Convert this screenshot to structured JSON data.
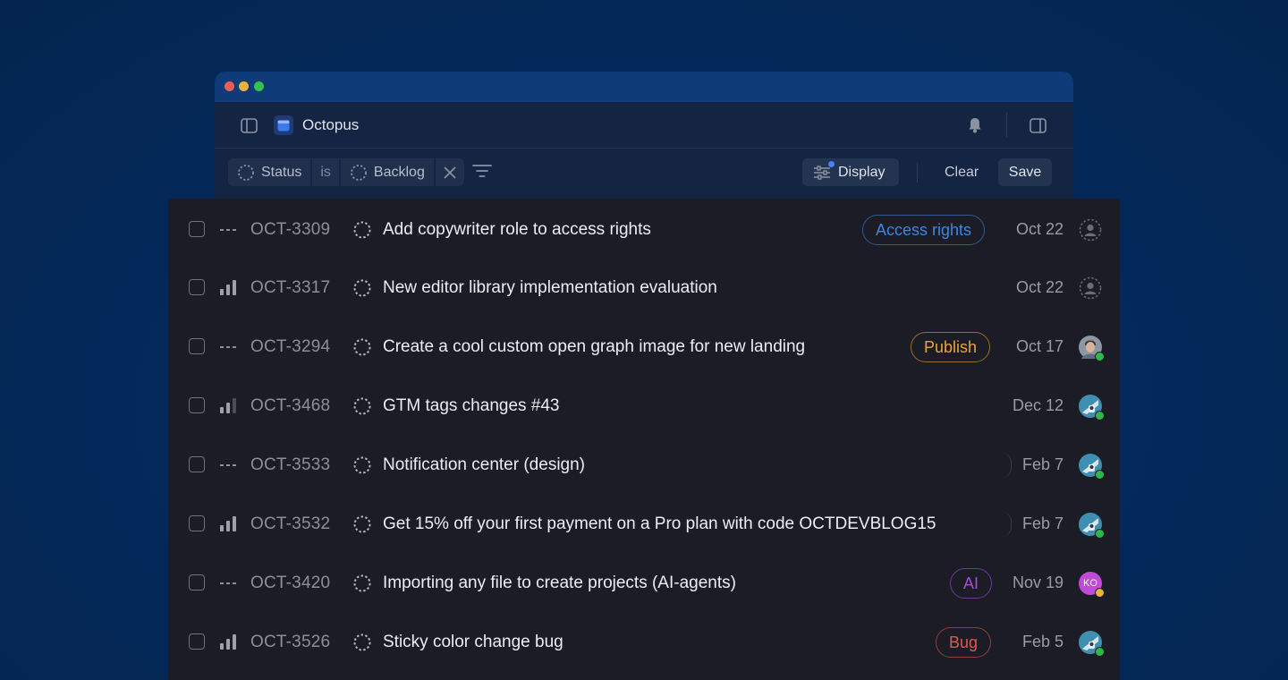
{
  "app": {
    "project_name": "Octopus"
  },
  "filter": {
    "field": "Status",
    "operator": "is",
    "value": "Backlog"
  },
  "toolbar": {
    "display_label": "Display",
    "clear_label": "Clear",
    "save_label": "Save"
  },
  "colors": {
    "access_rights": "#3d86e0",
    "publish": "#e8a33c",
    "ai": "#a24fe0",
    "bug": "#e0574f",
    "online": "#2fb84a",
    "away": "#e9b23b"
  },
  "issues": [
    {
      "id": "OCT-3309",
      "priority": "none",
      "title": "Add copywriter role to access rights",
      "tag": "Access rights",
      "date": "Oct 22",
      "assignee": "unassigned"
    },
    {
      "id": "OCT-3317",
      "priority": "high",
      "title": "New editor library implementation evaluation",
      "tag": "",
      "date": "Oct 22",
      "assignee": "unassigned"
    },
    {
      "id": "OCT-3294",
      "priority": "none",
      "title": "Create a cool custom open graph image for new landing",
      "tag": "Publish",
      "date": "Oct 17",
      "assignee": "photo-man"
    },
    {
      "id": "OCT-3468",
      "priority": "medium",
      "title": "GTM tags changes #43",
      "tag": "",
      "date": "Dec 12",
      "assignee": "illustration"
    },
    {
      "id": "OCT-3533",
      "priority": "none",
      "title": "Notification center (design)",
      "tag": "",
      "date": "Feb 7",
      "assignee": "illustration"
    },
    {
      "id": "OCT-3532",
      "priority": "high",
      "title": "Get 15% off your first payment on a Pro plan with code OCTDEVBLOG15",
      "tag": "",
      "date": "Feb 7",
      "assignee": "illustration"
    },
    {
      "id": "OCT-3420",
      "priority": "none",
      "title": "Importing any file to create projects (AI-agents)",
      "tag": "AI",
      "date": "Nov 19",
      "assignee": "KO"
    },
    {
      "id": "OCT-3526",
      "priority": "high",
      "title": "Sticky color change bug",
      "tag": "Bug",
      "date": "Feb 5",
      "assignee": "illustration"
    }
  ]
}
